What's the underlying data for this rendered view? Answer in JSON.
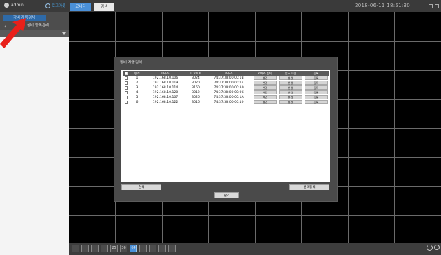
{
  "topbar": {
    "user": "admin",
    "logout_label": "로그아웃",
    "tabs": [
      "모니터",
      "검색"
    ],
    "clock": "2018-06-11 18:51:30"
  },
  "sidebar": {
    "items": [
      {
        "label": "장비 자동검색"
      },
      {
        "label": "장비 등록관리"
      }
    ]
  },
  "bottombar": {
    "layouts": [
      "",
      "",
      "",
      "",
      "25",
      "36",
      "64",
      "",
      "",
      "",
      ""
    ],
    "active_index": 6
  },
  "dialog": {
    "title": "장비 자동검색",
    "headers": [
      "번호",
      "IP주소",
      "TCP 포트",
      "맥주소",
      "카메라 선택",
      "업스트림",
      "등록"
    ],
    "rows": [
      {
        "no": "1",
        "ip": "192.168.10.106",
        "port": "3024",
        "mac": "74:37:3B:00:00:1B",
        "cam": "변경",
        "up": "변경",
        "reg": "등록"
      },
      {
        "no": "2",
        "ip": "192.168.10.119",
        "port": "3020",
        "mac": "74:37:3B:00:00:14",
        "cam": "변경",
        "up": "변경",
        "reg": "등록"
      },
      {
        "no": "3",
        "ip": "192.168.10.114",
        "port": "3160",
        "mac": "74:37:3B:00:00:A0",
        "cam": "변경",
        "up": "변경",
        "reg": "등록"
      },
      {
        "no": "4",
        "ip": "192.168.10.120",
        "port": "3012",
        "mac": "74:37:3B:00:00:0C",
        "cam": "변경",
        "up": "변경",
        "reg": "등록"
      },
      {
        "no": "5",
        "ip": "192.168.10.107",
        "port": "3026",
        "mac": "74:37:3B:00:00:1A",
        "cam": "변경",
        "up": "변경",
        "reg": "등록"
      },
      {
        "no": "6",
        "ip": "192.168.10.122",
        "port": "3016",
        "mac": "74:37:3B:00:00:10",
        "cam": "변경",
        "up": "변경",
        "reg": "등록"
      }
    ],
    "refresh_label": "검색",
    "register_selected_label": "선택등록",
    "close_label": "닫기"
  },
  "colors": {
    "accent": "#4a90d9",
    "arrow": "#e8201a",
    "grid_bg": "#000000"
  }
}
